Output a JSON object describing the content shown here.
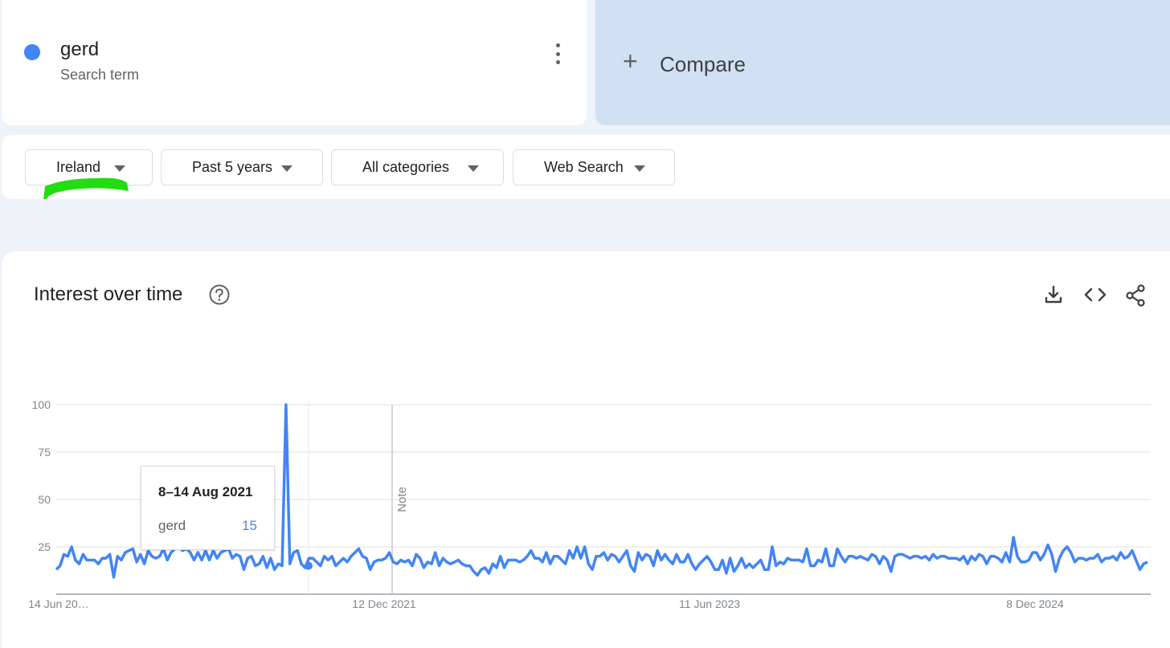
{
  "search_term": {
    "name": "gerd",
    "label": "Search term",
    "color": "#4285f4",
    "menu_icon": "more-vert-icon"
  },
  "compare": {
    "icon": "plus-icon",
    "label": "Compare"
  },
  "filters": [
    {
      "label": "Ireland"
    },
    {
      "label": "Past 5 years"
    },
    {
      "label": "All categories"
    },
    {
      "label": "Web Search"
    }
  ],
  "chart_section": {
    "title": "Interest over time",
    "help_icon": "help-icon",
    "actions": [
      "download-icon",
      "embed-icon",
      "share-icon"
    ]
  },
  "tooltip": {
    "date": "8–14 Aug 2021",
    "term": "gerd",
    "value": "15"
  },
  "note_label": "Note",
  "chart_data": {
    "type": "line",
    "x_labels": [
      "14 Jun 20…",
      "12 Dec 2021",
      "11 Jun 2023",
      "8 Dec 2024"
    ],
    "y_ticks": [
      25,
      50,
      75,
      100
    ],
    "ylim": [
      0,
      100
    ],
    "grid": true,
    "series": [
      {
        "name": "gerd",
        "color": "#4285f4",
        "values": [
          13,
          15,
          21,
          20,
          25,
          18,
          16,
          21,
          18,
          18,
          18,
          16,
          19,
          19,
          21,
          9,
          20,
          18,
          22,
          23,
          24,
          17,
          21,
          16,
          23,
          20,
          19,
          20,
          24,
          18,
          22,
          24,
          25,
          23,
          24,
          22,
          18,
          22,
          18,
          23,
          18,
          23,
          19,
          22,
          23,
          24,
          19,
          21,
          20,
          13,
          19,
          20,
          15,
          16,
          20,
          14,
          19,
          13,
          16,
          15,
          100,
          16,
          22,
          23,
          16,
          14,
          19,
          19,
          17,
          15,
          20,
          18,
          20,
          15,
          17,
          19,
          17,
          20,
          22,
          24,
          20,
          19,
          13,
          17,
          18,
          18,
          19,
          22,
          17,
          16,
          18,
          17,
          18,
          15,
          21,
          19,
          14,
          17,
          16,
          22,
          15,
          19,
          17,
          16,
          17,
          18,
          16,
          15,
          15,
          12,
          10,
          13,
          14,
          11,
          16,
          14,
          20,
          14,
          18,
          18,
          18,
          17,
          18,
          20,
          23,
          19,
          19,
          17,
          22,
          16,
          20,
          20,
          18,
          16,
          23,
          19,
          25,
          19,
          25,
          16,
          13,
          20,
          20,
          22,
          18,
          21,
          20,
          17,
          20,
          23,
          15,
          12,
          22,
          18,
          21,
          20,
          15,
          23,
          18,
          21,
          18,
          16,
          21,
          17,
          17,
          21,
          16,
          13,
          16,
          18,
          20,
          17,
          13,
          13,
          18,
          11,
          19,
          12,
          15,
          19,
          14,
          16,
          14,
          16,
          18,
          13,
          13,
          25,
          15,
          17,
          16,
          19,
          18,
          18,
          18,
          17,
          24,
          15,
          15,
          18,
          17,
          24,
          15,
          15,
          24,
          20,
          17,
          20,
          20,
          19,
          20,
          19,
          18,
          21,
          20,
          16,
          20,
          18,
          12,
          20,
          21,
          21,
          20,
          19,
          20,
          20,
          19,
          20,
          18,
          21,
          19,
          20,
          20,
          19,
          19,
          19,
          18,
          20,
          16,
          20,
          18,
          21,
          20,
          16,
          20,
          20,
          19,
          17,
          22,
          17,
          30,
          20,
          17,
          17,
          18,
          22,
          22,
          18,
          21,
          26,
          21,
          12,
          19,
          23,
          25,
          22,
          17,
          19,
          19,
          18,
          19,
          19,
          21,
          17,
          19,
          19,
          20,
          18,
          22,
          19,
          20,
          23,
          18,
          13,
          16,
          17
        ]
      }
    ]
  }
}
